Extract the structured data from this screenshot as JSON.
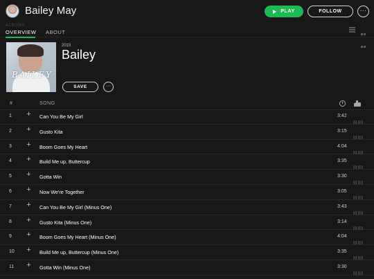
{
  "header": {
    "artist_name": "Bailey May",
    "play_label": "PLAY",
    "follow_label": "FOLLOW",
    "more_label": "···"
  },
  "tabs": {
    "albums_label": "ALBUMS",
    "overview_label": "OVERVIEW",
    "about_label": "ABOUT",
    "active": "OVERVIEW"
  },
  "album": {
    "year": "2015",
    "title": "Bailey",
    "cover_text": "BAILEY",
    "save_label": "SAVE",
    "more_label": "···"
  },
  "table": {
    "col_number": "#",
    "col_song": "SONG",
    "tracks": [
      {
        "number": "1",
        "title": "Can You Be My Girl",
        "duration": "3:42"
      },
      {
        "number": "2",
        "title": "Gusto Kita",
        "duration": "3:15"
      },
      {
        "number": "3",
        "title": "Boom Goes My Heart",
        "duration": "4:04"
      },
      {
        "number": "4",
        "title": "Build Me up, Buttercup",
        "duration": "3:35"
      },
      {
        "number": "5",
        "title": "Gotta Win",
        "duration": "3:30"
      },
      {
        "number": "6",
        "title": "Now We're Together",
        "duration": "3:05"
      },
      {
        "number": "7",
        "title": "Can You Be My Girl (Minus One)",
        "duration": "3:43"
      },
      {
        "number": "8",
        "title": "Gusto Kita (Minus One)",
        "duration": "3:14"
      },
      {
        "number": "9",
        "title": "Boom Goes My Heart (Minus One)",
        "duration": "4:04"
      },
      {
        "number": "10",
        "title": "Build Me up, Buttercup (Minus One)",
        "duration": "3:35"
      },
      {
        "number": "11",
        "title": "Gotta Win (Minus One)",
        "duration": "3:30"
      }
    ]
  },
  "colors": {
    "background": "#181818",
    "accent": "#1db954",
    "text": "#ffffff",
    "muted": "#a7a7a7"
  }
}
